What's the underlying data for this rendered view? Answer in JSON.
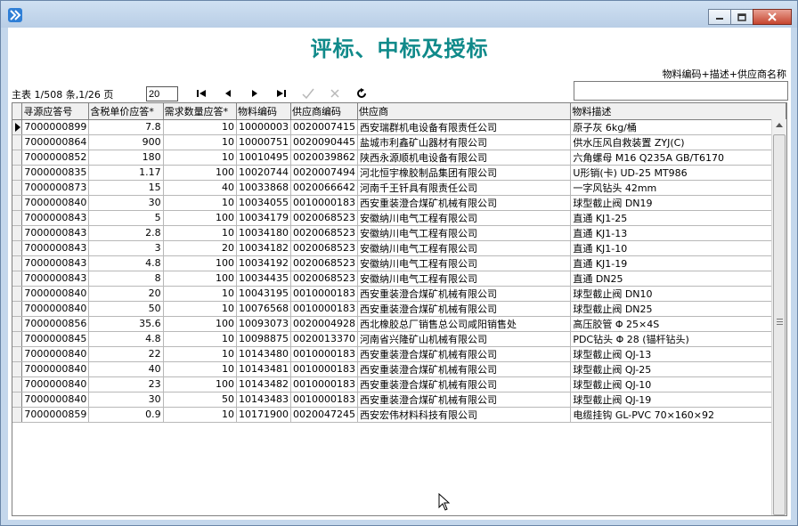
{
  "window": {
    "app_icon": "double-chevron-right-icon"
  },
  "header": {
    "title": "评标、中标及授标"
  },
  "search": {
    "label": "物料编码+描述+供应商名称",
    "value": ""
  },
  "pager": {
    "status": "主表 1/508 条,1/26 页",
    "page_value": "20"
  },
  "grid": {
    "columns": [
      "寻源应答号",
      "含税单价应答*",
      "需求数量应答*",
      "物料编码",
      "供应商编码",
      "供应商",
      "物料描述"
    ],
    "rows": [
      [
        "7000000899",
        "7.8",
        "10",
        "10000003",
        "0020007415",
        "西安瑞群机电设备有限责任公司",
        "原子灰 6kg/桶"
      ],
      [
        "7000000864",
        "900",
        "10",
        "10000751",
        "0020090445",
        "盐城市利鑫矿山器材有限公司",
        "供水压风自救装置 ZYJ(C)"
      ],
      [
        "7000000852",
        "180",
        "10",
        "10010495",
        "0020039862",
        "陕西永源顺机电设备有限公司",
        "六角螺母 M16 Q235A GB/T6170"
      ],
      [
        "7000000835",
        "1.17",
        "100",
        "10020744",
        "0020007494",
        "河北恒宇橡胶制品集团有限公司",
        "U形销(卡) UD-25 MT986"
      ],
      [
        "7000000873",
        "15",
        "40",
        "10033868",
        "0020066642",
        "河南千王钎具有限责任公司",
        "一字风钻头 42mm"
      ],
      [
        "7000000840",
        "30",
        "10",
        "10034055",
        "0010000183",
        "西安重装澄合煤矿机械有限公司",
        "球型截止阀 DN19"
      ],
      [
        "7000000843",
        "5",
        "100",
        "10034179",
        "0020068523",
        "安徽纳川电气工程有限公司",
        "直通 KJ1-25"
      ],
      [
        "7000000843",
        "2.8",
        "10",
        "10034180",
        "0020068523",
        "安徽纳川电气工程有限公司",
        "直通 KJ1-13"
      ],
      [
        "7000000843",
        "3",
        "20",
        "10034182",
        "0020068523",
        "安徽纳川电气工程有限公司",
        "直通 KJ1-10"
      ],
      [
        "7000000843",
        "4.8",
        "100",
        "10034192",
        "0020068523",
        "安徽纳川电气工程有限公司",
        "直通 KJ1-19"
      ],
      [
        "7000000843",
        "8",
        "100",
        "10034435",
        "0020068523",
        "安徽纳川电气工程有限公司",
        "直通 DN25"
      ],
      [
        "7000000840",
        "20",
        "10",
        "10043195",
        "0010000183",
        "西安重装澄合煤矿机械有限公司",
        "球型截止阀 DN10"
      ],
      [
        "7000000840",
        "50",
        "10",
        "10076568",
        "0010000183",
        "西安重装澄合煤矿机械有限公司",
        "球型截止阀 DN25"
      ],
      [
        "7000000856",
        "35.6",
        "100",
        "10093073",
        "0020004928",
        "西北橡胶总厂销售总公司咸阳销售处",
        "高压胶管 Φ 25×4S"
      ],
      [
        "7000000845",
        "4.8",
        "10",
        "10098875",
        "0020013370",
        "河南省兴隆矿山机械有限公司",
        "PDC钻头 Φ 28 (锚杆钻头)"
      ],
      [
        "7000000840",
        "22",
        "10",
        "10143480",
        "0010000183",
        "西安重装澄合煤矿机械有限公司",
        "球型截止阀 QJ-13"
      ],
      [
        "7000000840",
        "40",
        "10",
        "10143481",
        "0010000183",
        "西安重装澄合煤矿机械有限公司",
        "球型截止阀 QJ-25"
      ],
      [
        "7000000840",
        "23",
        "100",
        "10143482",
        "0010000183",
        "西安重装澄合煤矿机械有限公司",
        "球型截止阀 QJ-10"
      ],
      [
        "7000000840",
        "30",
        "50",
        "10143483",
        "0010000183",
        "西安重装澄合煤矿机械有限公司",
        "球型截止阀 QJ-19"
      ],
      [
        "7000000859",
        "0.9",
        "10",
        "10171900",
        "0020047245",
        "西安宏伟材料科技有限公司",
        "电缆挂钩 GL-PVC 70×160×92"
      ]
    ]
  },
  "colors": {
    "title": "#108a8a",
    "frame": "#c4d7ec"
  }
}
